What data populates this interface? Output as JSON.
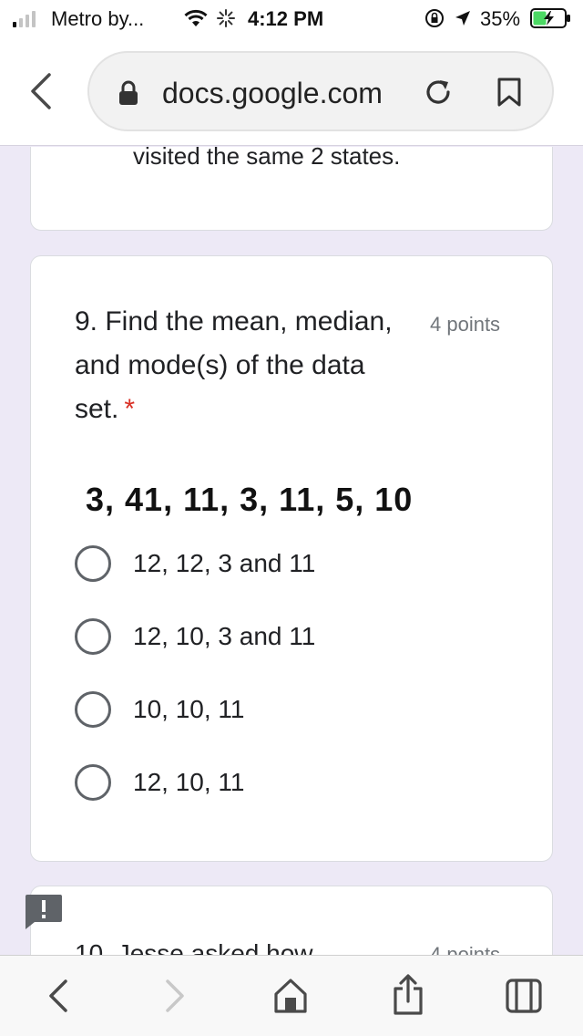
{
  "status_bar": {
    "carrier": "Metro by...",
    "time": "4:12 PM",
    "battery_percent": "35%",
    "signal_bars_on": 1,
    "signal_bars_total": 4,
    "icons": [
      "wifi-icon",
      "activity-spinner-icon",
      "orientation-lock-icon",
      "location-arrow-icon",
      "battery-charging-icon"
    ]
  },
  "browser": {
    "url": "docs.google.com",
    "icons": [
      "back-chevron-icon",
      "padlock-icon",
      "reload-icon",
      "bookmark-icon"
    ]
  },
  "previous_question": {
    "partial_text": "visited the same 2 states."
  },
  "question_9": {
    "title": "9. Find the mean, median, and mode(s) of the data set.",
    "required_marker": "*",
    "points": "4 points",
    "data_set": "3, 41, 11, 3, 11, 5, 10",
    "options": [
      {
        "label": "12, 12, 3 and 11",
        "selected": false
      },
      {
        "label": "12, 10, 3 and 11",
        "selected": false
      },
      {
        "label": "10, 10, 11",
        "selected": false
      },
      {
        "label": "12, 10, 11",
        "selected": false
      }
    ]
  },
  "question_10": {
    "partial_title": "10. Jesse asked how",
    "points": "4 points"
  },
  "bottom_toolbar": {
    "icons": [
      "back-arrow-icon",
      "forward-arrow-icon",
      "home-icon",
      "share-icon",
      "tabs-icon"
    ]
  },
  "colors": {
    "page_background": "#ede9f6",
    "required_star": "#d93025",
    "muted_text": "#70757a"
  }
}
